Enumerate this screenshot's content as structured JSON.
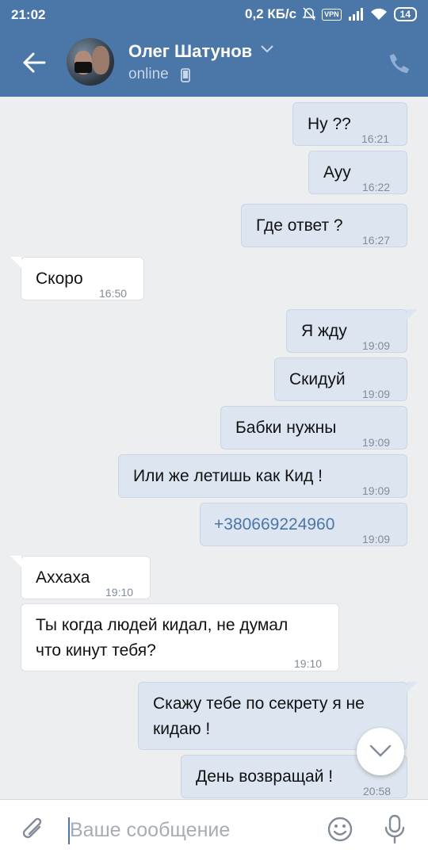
{
  "status_bar": {
    "time": "21:02",
    "speed": "0,2 КБ/с",
    "vpn": "VPN",
    "battery": "14"
  },
  "header": {
    "name": "Олег Шатунов",
    "presence": "online"
  },
  "messages": [
    {
      "dir": "out",
      "text": "Ну ??",
      "time": "16:21"
    },
    {
      "dir": "out",
      "text": "Ауу",
      "time": "16:22"
    },
    {
      "dir": "out",
      "text": "Где ответ ?",
      "time": "16:27"
    },
    {
      "dir": "in",
      "text": "Скоро",
      "time": "16:50"
    },
    {
      "dir": "out",
      "text": "Я жду",
      "time": "19:09"
    },
    {
      "dir": "out",
      "text": "Скидуй",
      "time": "19:09"
    },
    {
      "dir": "out",
      "text": "Бабки нужны",
      "time": "19:09"
    },
    {
      "dir": "out",
      "text": "Или же летишь как Кид !",
      "time": "19:09"
    },
    {
      "dir": "out",
      "text": "+380669224960",
      "time": "19:09"
    },
    {
      "dir": "in",
      "text": "Аххаха",
      "time": "19:10"
    },
    {
      "dir": "in",
      "text_line1": "Ты когда людей кидал, не думал",
      "text_line2": "что кинут тебя?",
      "time": "19:10"
    },
    {
      "dir": "out",
      "text_line1": "Скажу тебе по секрету я не",
      "text_line2": "кидаю !",
      "time": ""
    },
    {
      "dir": "out",
      "text": "День возвращай !",
      "time": "20:58"
    }
  ],
  "input": {
    "placeholder": "Ваше сообщение"
  },
  "colors": {
    "header": "#4a76a8",
    "background": "#edeef0",
    "outgoing_bubble": "#dde6f0",
    "incoming_bubble": "#ffffff",
    "link": "#4a76a8"
  },
  "icons": [
    "back-arrow-icon",
    "chevron-down-icon",
    "mobile-phone-icon",
    "call-icon",
    "scroll-down-icon",
    "paperclip-icon",
    "emoji-icon",
    "microphone-icon"
  ]
}
